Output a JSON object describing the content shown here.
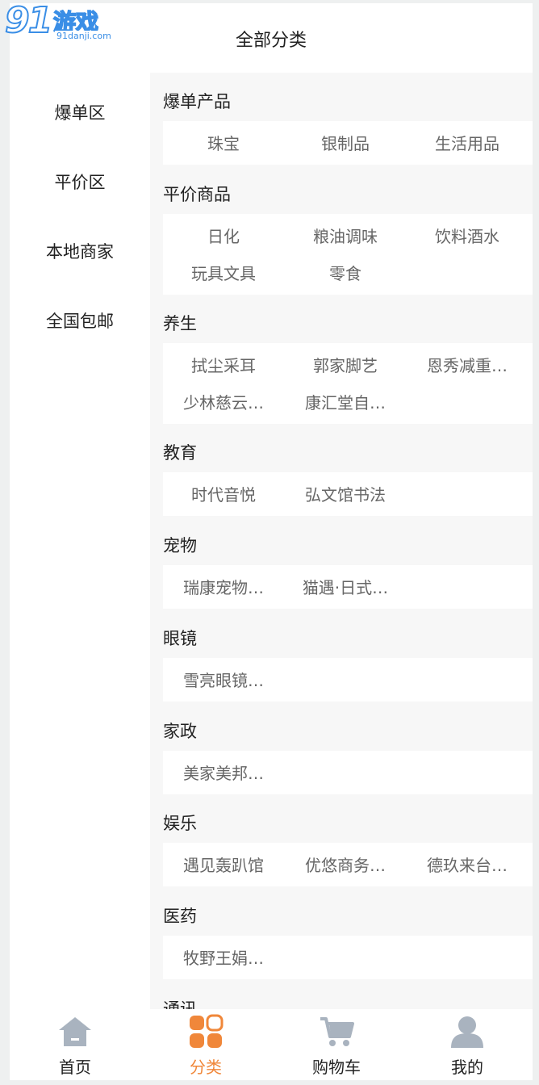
{
  "watermark": {
    "logo_num": "91",
    "logo_cn": "游戏",
    "url": "91danji.com"
  },
  "header": {
    "title": "全部分类"
  },
  "sidebar": {
    "items": [
      {
        "label": "爆单区"
      },
      {
        "label": "平价区"
      },
      {
        "label": "本地商家"
      },
      {
        "label": "全国包邮"
      }
    ]
  },
  "categories": [
    {
      "title": "爆单产品",
      "items": [
        "珠宝",
        "银制品",
        "生活用品"
      ]
    },
    {
      "title": "平价商品",
      "items": [
        "日化",
        "粮油调味",
        "饮料酒水",
        "玩具文具",
        "零食"
      ]
    },
    {
      "title": "养生",
      "items": [
        "拭尘采耳",
        "郭家脚艺",
        "恩秀减重…",
        "少林慈云…",
        "康汇堂自…"
      ]
    },
    {
      "title": "教育",
      "items": [
        "时代音悦",
        "弘文馆书法"
      ]
    },
    {
      "title": "宠物",
      "items": [
        "瑞康宠物…",
        "猫遇·日式…"
      ]
    },
    {
      "title": "眼镜",
      "items": [
        "雪亮眼镜…"
      ]
    },
    {
      "title": "家政",
      "items": [
        "美家美邦…"
      ]
    },
    {
      "title": "娱乐",
      "items": [
        "遇见轰趴馆",
        "优悠商务…",
        "德玖来台…"
      ]
    },
    {
      "title": "医药",
      "items": [
        "牧野王娟…"
      ]
    },
    {
      "title": "通讯",
      "items": []
    }
  ],
  "tabbar": {
    "tabs": [
      {
        "label": "首页",
        "icon": "home-icon"
      },
      {
        "label": "分类",
        "icon": "category-icon",
        "active": true
      },
      {
        "label": "购物车",
        "icon": "cart-icon"
      },
      {
        "label": "我的",
        "icon": "user-icon"
      }
    ]
  },
  "colors": {
    "accent": "#f0873a",
    "icon_gray": "#a9b3bf",
    "watermark_blue": "#3a8ee6"
  }
}
